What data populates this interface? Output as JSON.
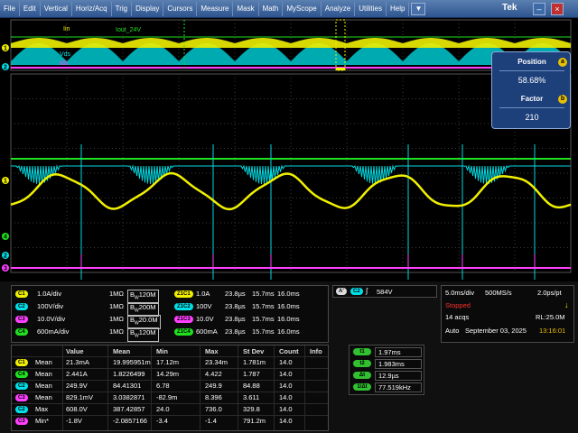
{
  "menu": [
    "File",
    "Edit",
    "Vertical",
    "Horiz/Acq",
    "Trig",
    "Display",
    "Cursors",
    "Measure",
    "Mask",
    "Math",
    "MyScope",
    "Analyze",
    "Utilities",
    "Help"
  ],
  "menu_dropdown": "▼",
  "brand": "Tek",
  "window_buttons": {
    "minimize": "–",
    "close": "×"
  },
  "zoom_labels": {
    "iin": "Iin",
    "iout": "Iout_24V",
    "vds": "Vds",
    "ids": "Ids"
  },
  "left_markers": [
    "1",
    "2",
    "1",
    "2",
    "3",
    "4"
  ],
  "position_box": {
    "position_label": "Position",
    "position_knob": "a",
    "position_value": "58.68%",
    "factor_label": "Factor",
    "factor_knob": "b",
    "factor_value": "210"
  },
  "colors": {
    "ch1": "#f0f000",
    "ch2": "#00e0e8",
    "ch3": "#ff40ff",
    "ch4": "#20e020",
    "grid": "#3a3a3a",
    "menubar": "#2e5590"
  },
  "channels": [
    {
      "badge": "C1",
      "scale": "1.0A/div",
      "imp": "1MΩ",
      "bw": "120M",
      "color": "#f0f000"
    },
    {
      "badge": "C2",
      "scale": "100V/div",
      "imp": "1MΩ",
      "bw": "200M",
      "color": "#00e0e8"
    },
    {
      "badge": "C3",
      "scale": "10.0V/div",
      "imp": "1MΩ",
      "bw": "20.0M",
      "color": "#ff40ff"
    },
    {
      "badge": "C4",
      "scale": "600mA/div",
      "imp": "1MΩ",
      "bw": "120M",
      "color": "#20e020"
    }
  ],
  "bw_prefix": "B",
  "bw_sub": "W",
  "zooms": [
    {
      "badge": "Z1C1",
      "scale": "1.0A",
      "t1": "23.8µs",
      "t2": "15.7ms",
      "t3": "16.0ms",
      "color": "#f0f000"
    },
    {
      "badge": "Z1C2",
      "scale": "100V",
      "t1": "23.8µs",
      "t2": "15.7ms",
      "t3": "16.0ms",
      "color": "#00e0e8"
    },
    {
      "badge": "Z1C3",
      "scale": "10.0V",
      "t1": "23.8µs",
      "t2": "15.7ms",
      "t3": "16.0ms",
      "color": "#ff40ff"
    },
    {
      "badge": "Z1C4",
      "scale": "600mA",
      "t1": "23.8µs",
      "t2": "15.7ms",
      "t3": "16.0ms",
      "color": "#20e020"
    }
  ],
  "trigger": {
    "a_badge": "A'",
    "ch_badge": "C2",
    "slope": "∫",
    "level": "584V"
  },
  "horizontal": {
    "scale": "5.0ms/div",
    "rate": "500MS/s",
    "res": "2.0ps/pt",
    "status": "Stopped",
    "acqs": "14 acqs",
    "rl": "RL:25.0M",
    "mode": "Auto",
    "date": "September 03, 2025",
    "time": "13:16:01",
    "marker": "↓"
  },
  "measurements": {
    "headers": [
      "Value",
      "Mean",
      "Min",
      "Max",
      "St Dev",
      "Count",
      "Info"
    ],
    "rows": [
      {
        "badge": "C1",
        "name": "Mean",
        "value": "21.3mA",
        "mean": "19.995951m",
        "min": "17.12m",
        "max": "23.34m",
        "stdev": "1.781m",
        "count": "14.0",
        "color": "#f0f000"
      },
      {
        "badge": "C4",
        "name": "Mean",
        "value": "2.441A",
        "mean": "1.8226499",
        "min": "14.29m",
        "max": "4.422",
        "stdev": "1.787",
        "count": "14.0",
        "color": "#20e020"
      },
      {
        "badge": "C2",
        "name": "Mean",
        "value": "249.9V",
        "mean": "84.41301",
        "min": "6.78",
        "max": "249.9",
        "stdev": "84.88",
        "count": "14.0",
        "color": "#00e0e8"
      },
      {
        "badge": "C3",
        "name": "Mean",
        "value": "829.1mV",
        "mean": "3.0382871",
        "min": "-82.9m",
        "max": "8.396",
        "stdev": "3.611",
        "count": "14.0",
        "color": "#ff40ff"
      },
      {
        "badge": "C2",
        "name": "Max",
        "value": "608.0V",
        "mean": "387.42857",
        "min": "24.0",
        "max": "736.0",
        "stdev": "329.8",
        "count": "14.0",
        "color": "#00e0e8"
      },
      {
        "badge": "C3",
        "name": "Min*",
        "value": "-1.8V",
        "mean": "-2.0857166",
        "min": "-3.4",
        "max": "-1.4",
        "stdev": "791.2m",
        "count": "14.0",
        "color": "#ff40ff"
      }
    ]
  },
  "cursors": [
    {
      "badge": "t1",
      "value": "1.97ms"
    },
    {
      "badge": "t2",
      "value": "1.983ms"
    },
    {
      "badge": "Δt",
      "value": "12.9µs"
    },
    {
      "badge": "1/Δt",
      "value": "77.519kHz"
    }
  ]
}
